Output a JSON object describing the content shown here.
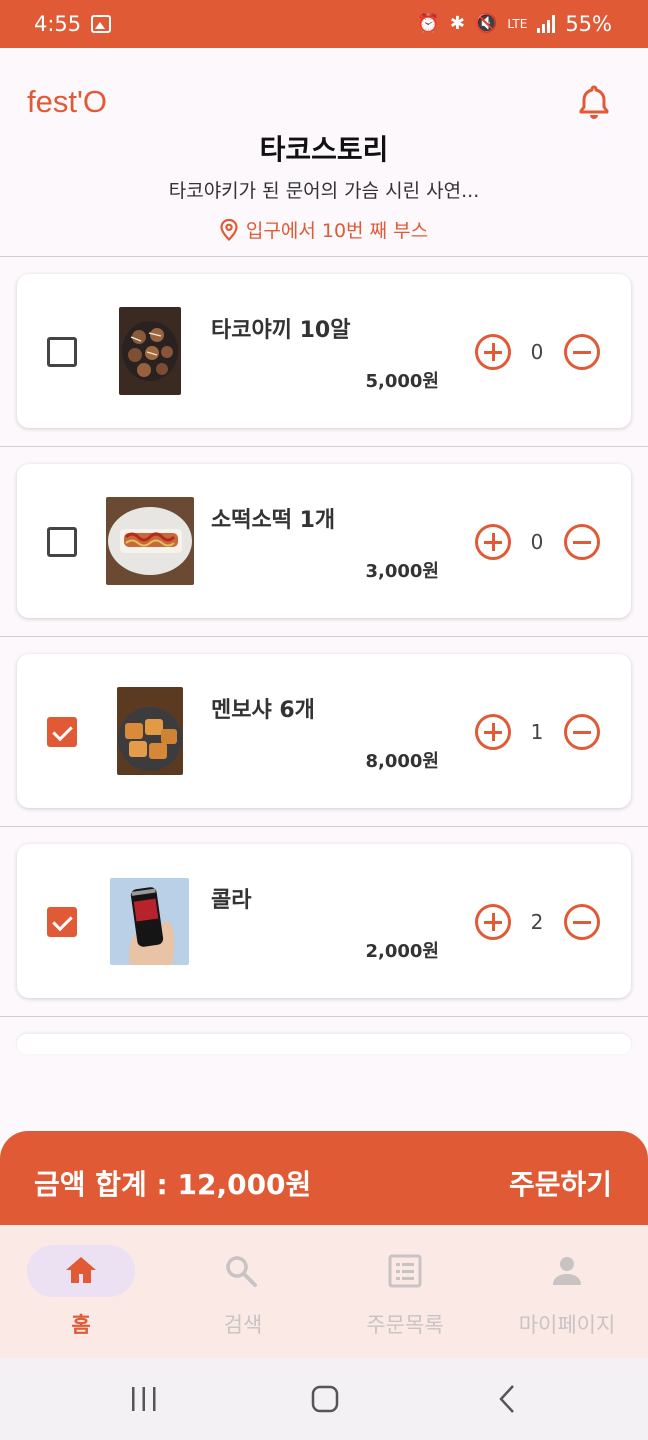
{
  "status_bar": {
    "time": "4:55",
    "network": "LTE",
    "battery": "55%",
    "icons": [
      "gallery-icon",
      "alarm-icon",
      "bluetooth-icon",
      "mute-icon",
      "lte-icon",
      "signal-icon",
      "battery-icon"
    ]
  },
  "header": {
    "logo": "fest'O",
    "store_name": "타코스토리",
    "store_desc": "타코야키가 된 문어의 가슴 시린 사연...",
    "location": "입구에서 10번 째 부스"
  },
  "menu": {
    "items": [
      {
        "name": "타코야끼 10알",
        "price": "5,000원",
        "qty": "0",
        "checked": false
      },
      {
        "name": "소떡소떡 1개",
        "price": "3,000원",
        "qty": "0",
        "checked": false
      },
      {
        "name": "멘보샤 6개",
        "price": "8,000원",
        "qty": "1",
        "checked": true
      },
      {
        "name": "콜라",
        "price": "2,000원",
        "qty": "2",
        "checked": true
      }
    ]
  },
  "order_bar": {
    "total_label": "금액 합계 : 12,000원",
    "order_button": "주문하기"
  },
  "bottom_nav": {
    "items": [
      {
        "label": "홈",
        "icon": "home-icon",
        "active": true
      },
      {
        "label": "검색",
        "icon": "search-icon",
        "active": false
      },
      {
        "label": "주문목록",
        "icon": "list-icon",
        "active": false
      },
      {
        "label": "마이페이지",
        "icon": "person-icon",
        "active": false
      }
    ]
  },
  "colors": {
    "accent": "#e05a36",
    "nav_background": "#fbe9e6",
    "nav_active_pill": "#ece0f3",
    "nav_inactive": "#c9c3c3"
  }
}
